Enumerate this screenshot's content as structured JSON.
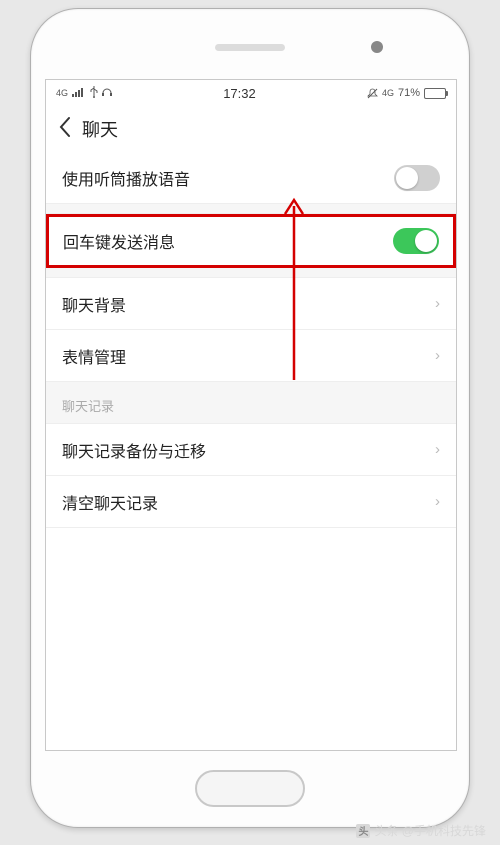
{
  "status_bar": {
    "network": "4G",
    "time": "17:32",
    "battery_percent": "71%",
    "signal_sub": "4G"
  },
  "nav": {
    "title": "聊天"
  },
  "items": {
    "earpiece": {
      "label": "使用听筒播放语音"
    },
    "enter_send": {
      "label": "回车键发送消息"
    },
    "background": {
      "label": "聊天背景"
    },
    "sticker": {
      "label": "表情管理"
    },
    "section_log": {
      "label": "聊天记录"
    },
    "backup": {
      "label": "聊天记录备份与迁移"
    },
    "clear": {
      "label": "清空聊天记录"
    }
  },
  "watermark": {
    "text": "头条 @手机科技先锋"
  }
}
